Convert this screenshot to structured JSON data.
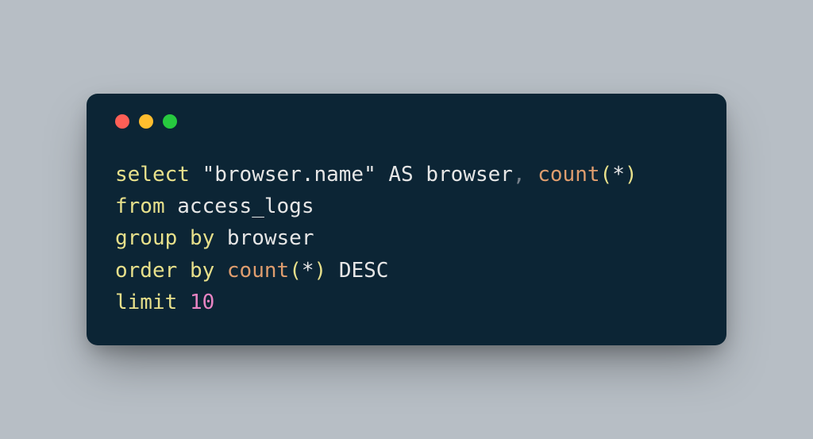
{
  "window": {
    "traffic_lights": [
      "red",
      "yellow",
      "green"
    ]
  },
  "code": {
    "tokens": [
      {
        "t": "kw",
        "v": "select"
      },
      {
        "t": "sp",
        "v": " "
      },
      {
        "t": "str",
        "v": "\"browser.name\""
      },
      {
        "t": "sp",
        "v": " "
      },
      {
        "t": "kwAS",
        "v": "AS"
      },
      {
        "t": "sp",
        "v": " "
      },
      {
        "t": "ident",
        "v": "browser"
      },
      {
        "t": "comma",
        "v": ","
      },
      {
        "t": "sp",
        "v": " "
      },
      {
        "t": "func",
        "v": "count"
      },
      {
        "t": "punct",
        "v": "("
      },
      {
        "t": "star",
        "v": "*"
      },
      {
        "t": "punct",
        "v": ")"
      },
      {
        "t": "nl",
        "v": "\n"
      },
      {
        "t": "kw",
        "v": "from"
      },
      {
        "t": "sp",
        "v": " "
      },
      {
        "t": "ident",
        "v": "access_logs"
      },
      {
        "t": "nl",
        "v": "\n"
      },
      {
        "t": "kw",
        "v": "group"
      },
      {
        "t": "sp",
        "v": " "
      },
      {
        "t": "kw",
        "v": "by"
      },
      {
        "t": "sp",
        "v": " "
      },
      {
        "t": "ident",
        "v": "browser"
      },
      {
        "t": "nl",
        "v": "\n"
      },
      {
        "t": "kw",
        "v": "order"
      },
      {
        "t": "sp",
        "v": " "
      },
      {
        "t": "kw",
        "v": "by"
      },
      {
        "t": "sp",
        "v": " "
      },
      {
        "t": "func",
        "v": "count"
      },
      {
        "t": "punct",
        "v": "("
      },
      {
        "t": "star",
        "v": "*"
      },
      {
        "t": "punct",
        "v": ")"
      },
      {
        "t": "sp",
        "v": " "
      },
      {
        "t": "kwDESC",
        "v": "DESC"
      },
      {
        "t": "nl",
        "v": "\n"
      },
      {
        "t": "kw",
        "v": "limit"
      },
      {
        "t": "sp",
        "v": " "
      },
      {
        "t": "num",
        "v": "10"
      }
    ]
  }
}
